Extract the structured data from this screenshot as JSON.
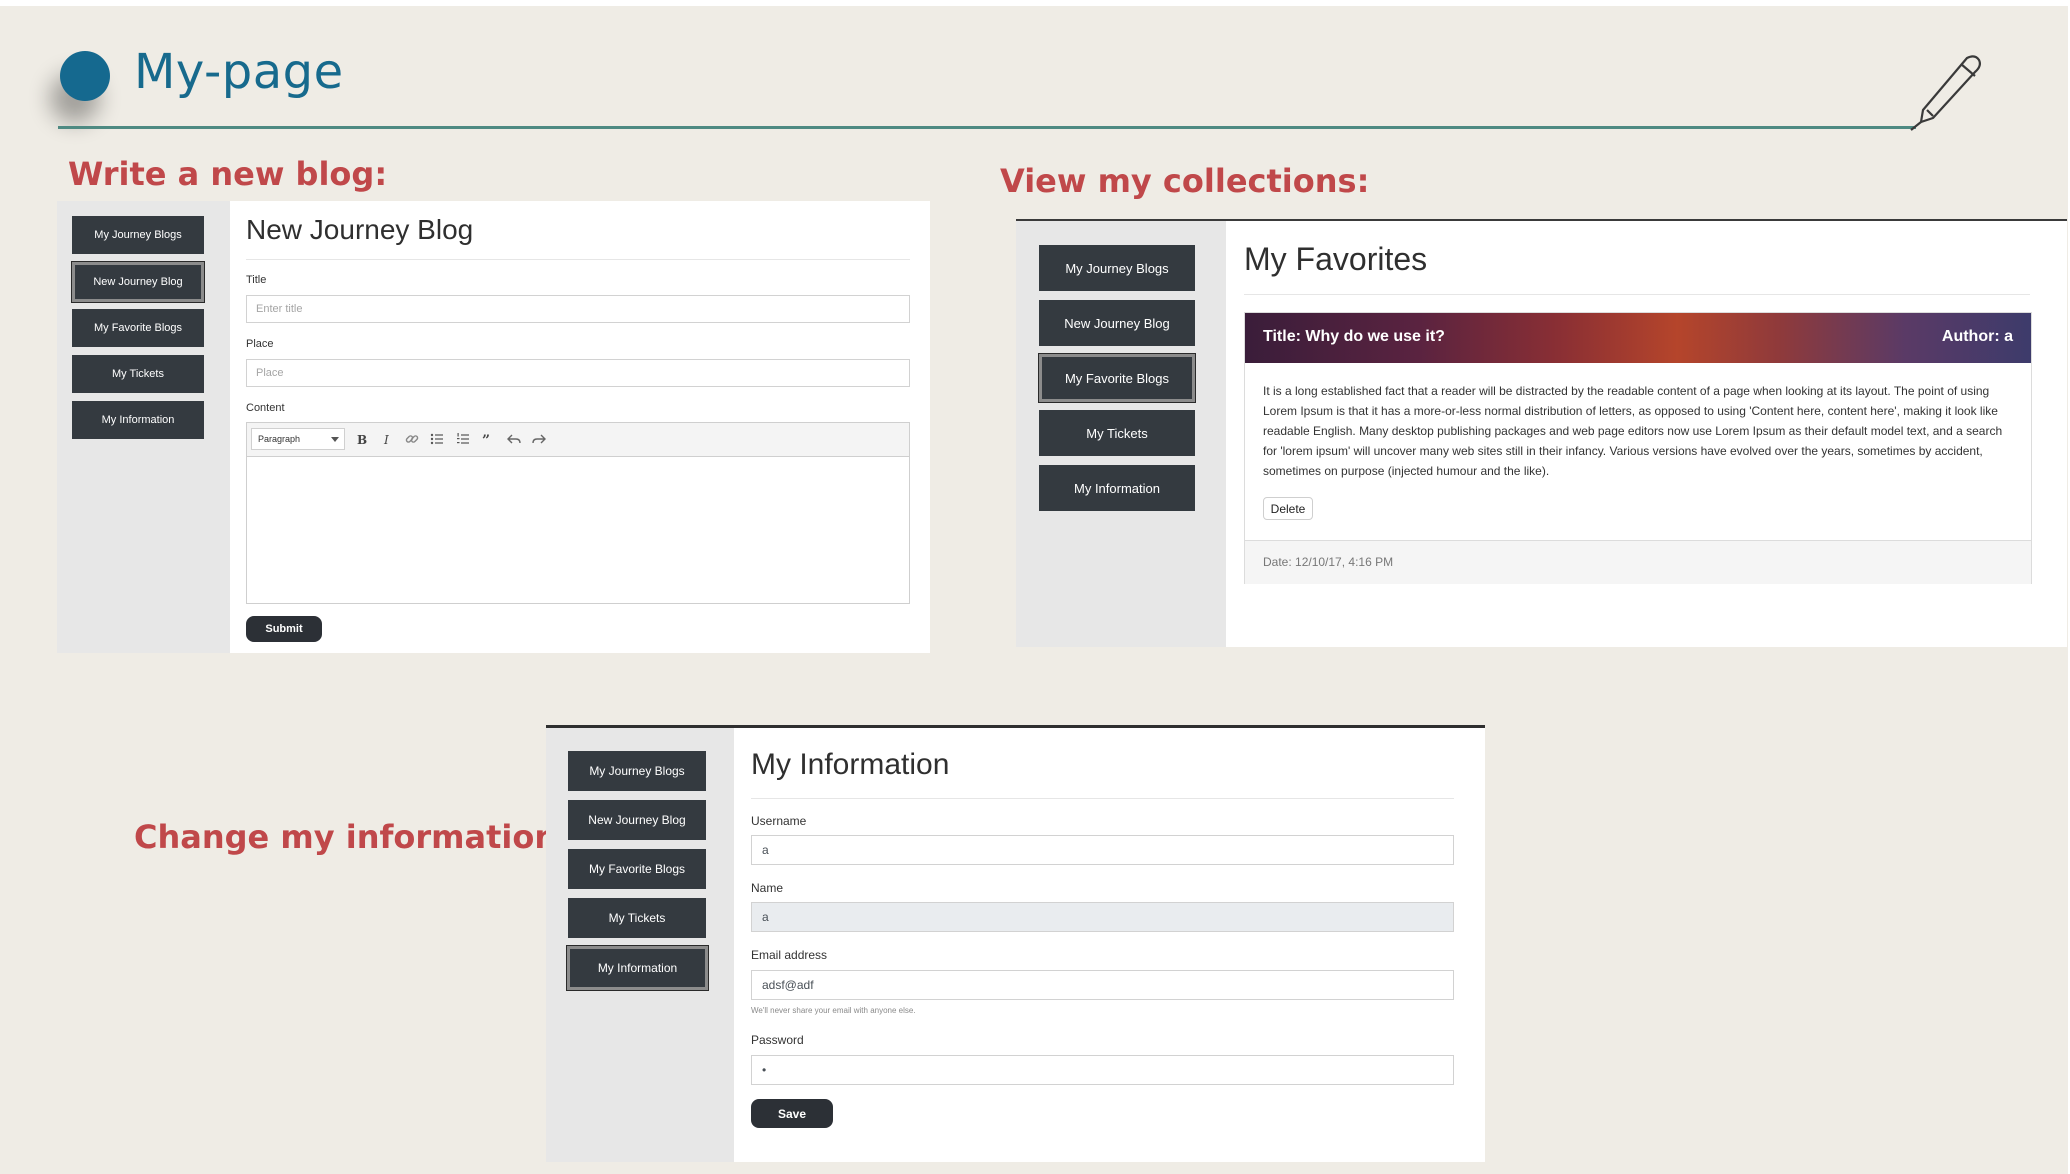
{
  "page": {
    "title": "My-page"
  },
  "sidebar_items": [
    "My Journey Blogs",
    "New Journey Blog",
    "My Favorite Blogs",
    "My Tickets",
    "My Information"
  ],
  "sections": {
    "write": "Write a new blog:",
    "collections": "View my collections:",
    "info": "Change my information:"
  },
  "new_blog": {
    "heading": "New Journey Blog",
    "title_label": "Title",
    "title_placeholder": "Enter title",
    "place_label": "Place",
    "place_placeholder": "Place",
    "content_label": "Content",
    "block_format": "Paragraph",
    "toolbar_icons": [
      "bold-icon",
      "italic-icon",
      "link-icon",
      "bulleted-list-icon",
      "numbered-list-icon",
      "blockquote-icon",
      "undo-icon",
      "redo-icon"
    ],
    "submit": "Submit"
  },
  "favorites": {
    "heading": "My Favorites",
    "card": {
      "title": "Title: Why do we use it?",
      "author": "Author: a",
      "body": "It is a long established fact that a reader will be distracted by the readable content of a page when looking at its layout. The point of using Lorem Ipsum is that it has a more-or-less normal distribution of letters, as opposed to using 'Content here, content here', making it look like readable English. Many desktop publishing packages and web page editors now use Lorem Ipsum as their default model text, and a search for 'lorem ipsum' will uncover many web sites still in their infancy. Various versions have evolved over the years, sometimes by accident, sometimes on purpose (injected humour and the like).",
      "delete": "Delete",
      "date": "Date: 12/10/17, 4:16 PM"
    }
  },
  "my_info": {
    "heading": "My Information",
    "username_label": "Username",
    "username_value": "a",
    "name_label": "Name",
    "name_value": "a",
    "email_label": "Email address",
    "email_value": "adsf@adf",
    "email_help": "We'll never share your email with anyone else.",
    "password_label": "Password",
    "password_value": "•",
    "save": "Save"
  },
  "colors": {
    "background": "#efece5",
    "title": "#176a8d",
    "heading_red": "#c0484a",
    "sidebar_button": "#343a40"
  }
}
